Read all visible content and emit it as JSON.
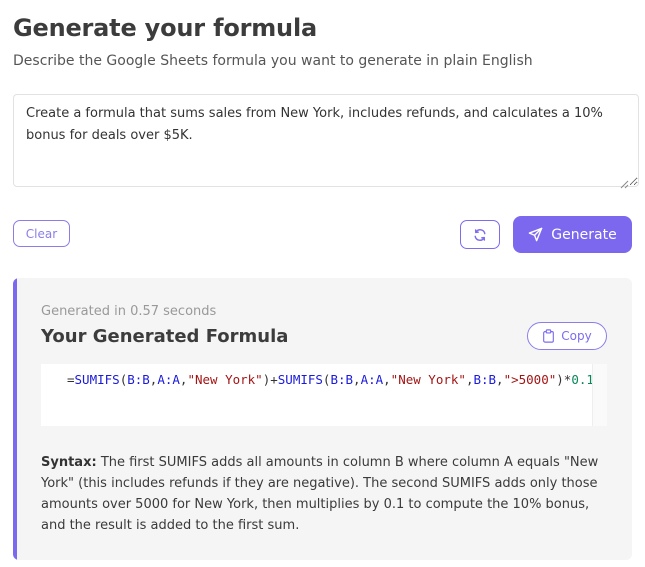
{
  "header": {
    "title": "Generate your formula",
    "subtitle": "Describe the Google Sheets formula you want to generate in plain English"
  },
  "prompt": {
    "value": "Create a formula that sums sales from New York, includes refunds, and calculates a 10% bonus for deals over $5K."
  },
  "actions": {
    "clear_label": "Clear",
    "refresh_icon": "refresh-icon",
    "generate_icon": "send-icon",
    "generate_label": "Generate"
  },
  "result": {
    "generated_in": "Generated in 0.57 seconds",
    "title": "Your Generated Formula",
    "copy_icon": "clipboard-icon",
    "copy_label": "Copy",
    "formula": "=SUMIFS(B:B,A:A,\"New York\")+SUMIFS(B:B,A:A,\"New York\",B:B,\">5000\")*0.1",
    "syntax_label": "Syntax:",
    "syntax_text": "The first SUMIFS adds all amounts in column B where column A equals \"New York\" (this includes refunds if they are negative). The second SUMIFS adds only those amounts over 5000 for New York, then multiplies by 0.1 to compute the 10% bonus, and the result is added to the first sum."
  },
  "colors": {
    "accent": "#7b68ee",
    "panel_bg": "#f5f5f5"
  }
}
